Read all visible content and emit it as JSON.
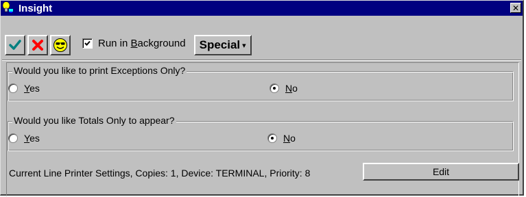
{
  "window": {
    "title": "Insight",
    "close_glyph": "✕"
  },
  "toolbar": {
    "ok_icon": "checkmark-icon",
    "cancel_icon": "red-x-icon",
    "smiley_icon": "sunglasses-smiley-icon",
    "run_in_background": {
      "prefix": "Run in ",
      "accel": "B",
      "suffix": "ackground",
      "checked": true
    },
    "special_label": "Special",
    "special_arrow": "▾"
  },
  "groups": [
    {
      "legend": "Would you like to print Exceptions Only?",
      "options": [
        {
          "accel": "Y",
          "rest": "es",
          "checked": false
        },
        {
          "accel": "N",
          "rest": "o",
          "checked": true
        }
      ]
    },
    {
      "legend": "Would you like Totals Only to appear?",
      "options": [
        {
          "accel": "Y",
          "rest": "es",
          "checked": false
        },
        {
          "accel": "N",
          "rest": "o",
          "checked": true
        }
      ]
    }
  ],
  "printer": {
    "settings_text": "Current Line Printer Settings, Copies: 1, Device: TERMINAL, Priority: 8",
    "edit_label": "Edit"
  },
  "colors": {
    "titlebar": "#000080",
    "face": "#c0c0c0",
    "check_green": "#008080",
    "cancel_red": "#ff0000"
  }
}
